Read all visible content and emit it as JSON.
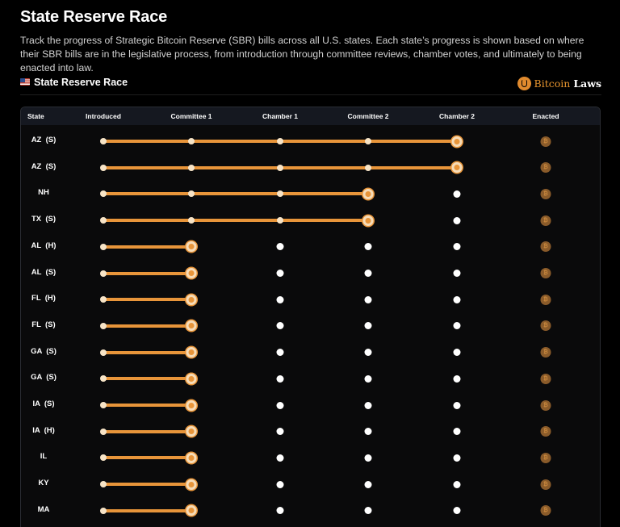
{
  "header": {
    "title": "State Reserve Race",
    "description": "Track the progress of Strategic Bitcoin Reserve (SBR) bills across all U.S. states. Each state’s progress is shown based on where their SBR bills are in the legislative process, from introduction through committee reviews, chamber votes, and ultimately to being enacted into law."
  },
  "section": {
    "flag_icon": "us-flag-icon",
    "title": "State Reserve Race",
    "brand_logo_icon": "bitcoin-laws-logo-icon",
    "brand_name_part1": "Bitcoin",
    "brand_name_part2": "Laws"
  },
  "table": {
    "columns": [
      "State",
      "Introduced",
      "Committee 1",
      "Chamber 1",
      "Committee 2",
      "Chamber 2",
      "Enacted"
    ],
    "enacted_icon": "bitcoin-coin-icon",
    "enacted_glyph": "₿",
    "colors": {
      "progress": "#e8953a",
      "pending_dot": "#ffffff",
      "enacted_coin": "#8a5b2a"
    },
    "rows": [
      {
        "state": "AZ  (S)",
        "stage": 4
      },
      {
        "state": "AZ  (S)",
        "stage": 4
      },
      {
        "state": "NH",
        "stage": 3
      },
      {
        "state": "TX  (S)",
        "stage": 3
      },
      {
        "state": "AL  (H)",
        "stage": 1
      },
      {
        "state": "AL  (S)",
        "stage": 1
      },
      {
        "state": "FL  (H)",
        "stage": 1
      },
      {
        "state": "FL  (S)",
        "stage": 1
      },
      {
        "state": "GA  (S)",
        "stage": 1
      },
      {
        "state": "GA  (S)",
        "stage": 1
      },
      {
        "state": "IA  (S)",
        "stage": 1
      },
      {
        "state": "IA  (H)",
        "stage": 1
      },
      {
        "state": "IL",
        "stage": 1
      },
      {
        "state": "KY",
        "stage": 1
      },
      {
        "state": "MA",
        "stage": 1
      }
    ]
  }
}
